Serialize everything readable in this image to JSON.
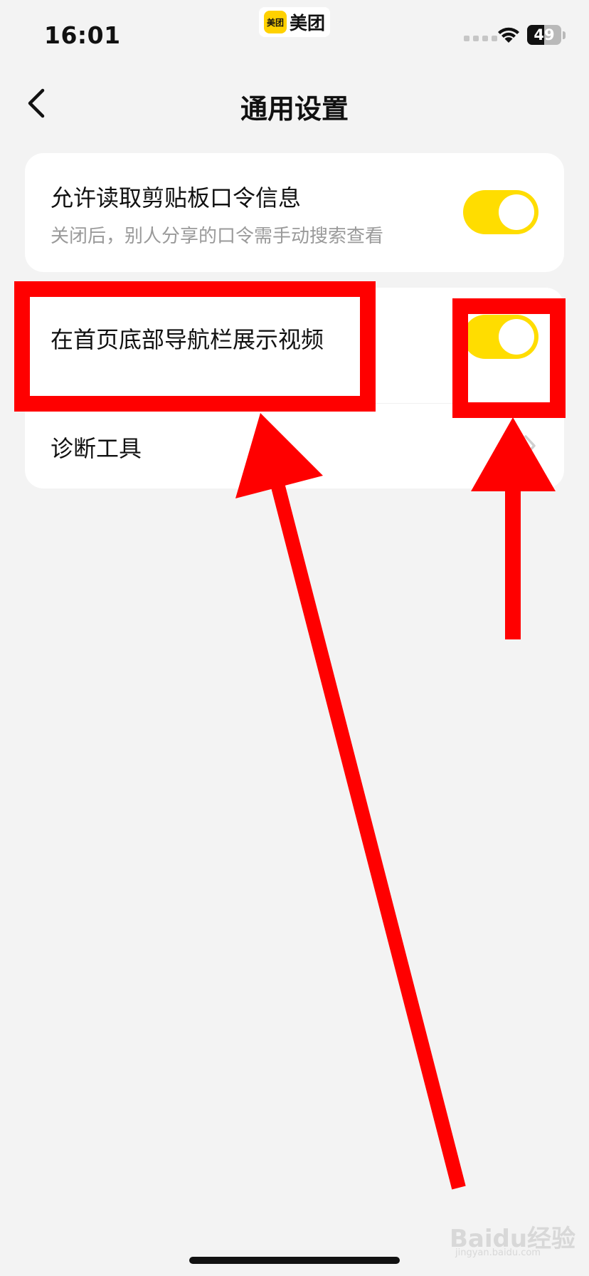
{
  "status_bar": {
    "time": "16:01",
    "app_logo_text": "美团",
    "app_name": "美团",
    "battery": "49",
    "icons": [
      "signal-dots-icon",
      "wifi-icon",
      "battery-icon"
    ]
  },
  "nav": {
    "title": "通用设置",
    "back_icon": "chevron-left-icon"
  },
  "settings": {
    "clipboard": {
      "title": "允许读取剪贴板口令信息",
      "subtitle": "关闭后，别人分享的口令需手动搜索查看",
      "enabled": true
    },
    "video_nav": {
      "title": "在首页底部导航栏展示视频",
      "enabled": true
    },
    "tools": {
      "title": "诊断工具",
      "icon": "chevron-right-icon"
    }
  },
  "colors": {
    "accent": "#ffdd00",
    "background": "#f3f3f3",
    "annotation": "#ff0000"
  },
  "watermark": {
    "text": "Baidu经验",
    "sub": "jingyan.baidu.com"
  }
}
